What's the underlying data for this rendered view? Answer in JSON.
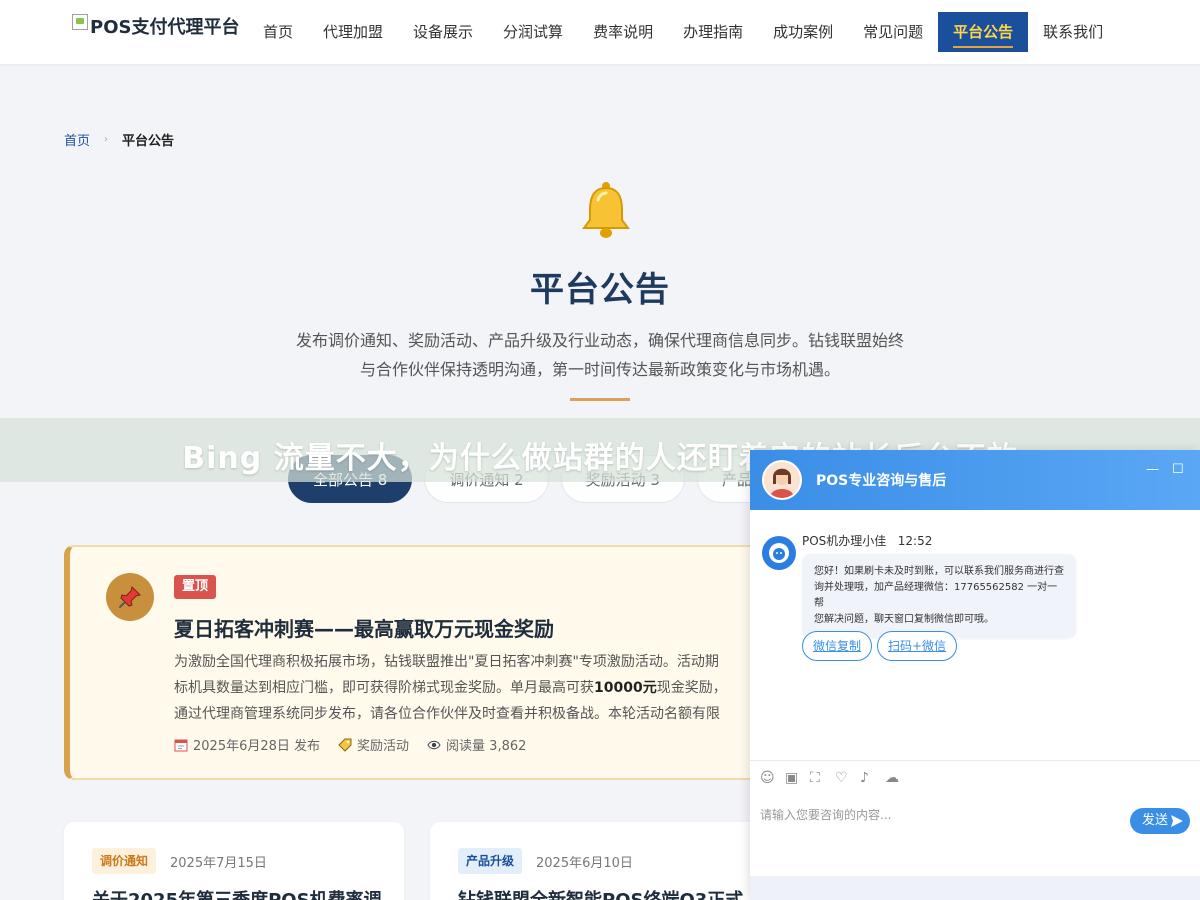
{
  "header": {
    "logo_alt": "POS支付代理平台",
    "nav": [
      "首页",
      "代理加盟",
      "设备展示",
      "分润试算",
      "费率说明",
      "办理指南",
      "成功案例",
      "常见问题",
      "平台公告",
      "联系我们"
    ],
    "active_index": 8
  },
  "breadcrumb": {
    "home": "首页",
    "separator": "›",
    "current": "平台公告"
  },
  "hero": {
    "icon": "bell-icon",
    "title": "平台公告",
    "desc_line1": "发布调价通知、奖励活动、产品升级及行业动态，确保代理商信息同步。钻钱联盟始终",
    "desc_line2": "与合作伙伴保持透明沟通，第一时间传达最新政策变化与市场机遇。"
  },
  "tabs": [
    {
      "label": "全部公告 8",
      "active": true
    },
    {
      "label": "调价通知 2",
      "active": false
    },
    {
      "label": "奖励活动 3",
      "active": false
    },
    {
      "label": "产品升级",
      "active": false
    }
  ],
  "overlay_banner": "Bing 流量不大，为什么做站群的人还盯着它的站长后台不放",
  "featured": {
    "badge": "置顶",
    "title": "夏日拓客冲刺赛——最高赢取万元现金奖励",
    "body_line1": "为激励全国代理商积极拓展市场，钻钱联盟推出\"夏日拓客冲刺赛\"专项激励活动。活动期",
    "body_line2_pre": "标机具数量达到相应门槛，即可获得阶梯式现金奖励。单月最高可获",
    "body_line2_bold": "10000元",
    "body_line2_post": "现金奖励，",
    "body_line3": "通过代理商管理系统同步发布，请各位合作伙伴及时查看并积极备战。本轮活动名额有限",
    "date": "2025年6月28日 发布",
    "category": "奖励活动",
    "views": "阅读量 3,862"
  },
  "cards": [
    {
      "tag": "调价通知",
      "date": "2025年7月15日",
      "title": "关于2025年第三季度POS机费率调"
    },
    {
      "tag": "产品升级",
      "date": "2025年6月10日",
      "title": "钻钱联盟全新智能POS终端Q3正式"
    }
  ],
  "chat": {
    "title": "POS专业咨询与售后",
    "minimize": "—",
    "maximize": "☐",
    "agent_name": "POS机办理小佳",
    "time": "12:52",
    "message_line1": "您好！如果刷卡未及时到账，可以联系我们服务商进行查",
    "message_line2": "询并处理哦，加产品经理微信：17765562582 一对一帮",
    "message_line3": "您解决问题，聊天窗口复制微信即可哦。",
    "btn_copy": "微信复制",
    "btn_scan": "扫码+微信",
    "input_placeholder": "请输入您要咨询的内容...",
    "send": "发送"
  },
  "colors": {
    "primary": "#1a4f9c",
    "accent": "#ffd54a",
    "chat_blue": "#3a8ee6",
    "gold": "#d6a24a",
    "sticky_red": "#d9534f"
  }
}
